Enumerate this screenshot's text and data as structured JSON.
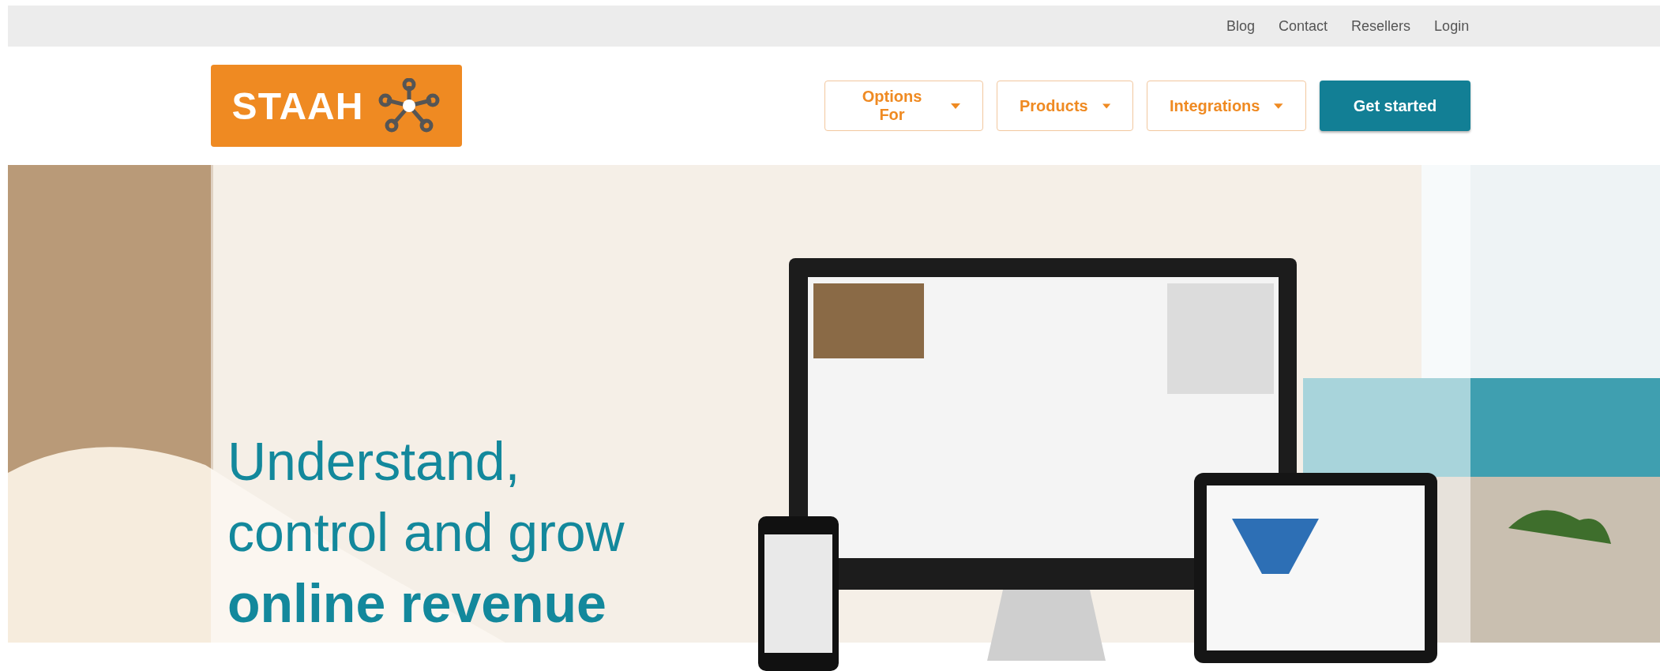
{
  "top_links": [
    {
      "label": "Blog"
    },
    {
      "label": "Contact"
    },
    {
      "label": "Resellers"
    },
    {
      "label": "Login"
    }
  ],
  "logo": {
    "text": "STAAH"
  },
  "nav": [
    {
      "label": "Options For",
      "kind": "dropdown"
    },
    {
      "label": "Products",
      "kind": "dropdown"
    },
    {
      "label": "Integrations",
      "kind": "dropdown"
    },
    {
      "label": "Get started",
      "kind": "primary"
    }
  ],
  "hero": {
    "headline": [
      "Understand,",
      "control and grow"
    ],
    "headline_bold": "online revenue"
  }
}
